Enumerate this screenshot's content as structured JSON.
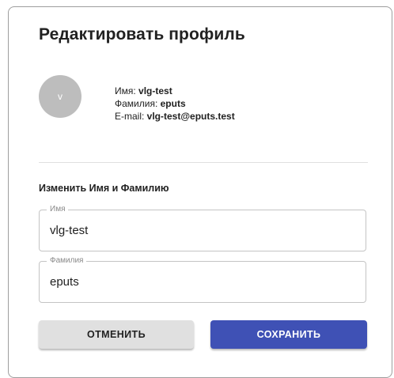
{
  "card": {
    "title": "Редактировать профиль"
  },
  "profile": {
    "avatar_letter": "v",
    "first_name_label": "Имя: ",
    "first_name": "vlg-test",
    "last_name_label": "Фамилия: ",
    "last_name": "eputs",
    "email_label": "E-mail: ",
    "email": "vlg-test@eputs.test"
  },
  "form": {
    "section_title": "Изменить Имя и Фамилию",
    "first_name_field": {
      "label": "Имя",
      "value": "vlg-test"
    },
    "last_name_field": {
      "label": "Фамилия",
      "value": "eputs"
    },
    "cancel_label": "ОТМЕНИТЬ",
    "save_label": "СОХРАНИТЬ"
  },
  "colors": {
    "primary": "#3f51b5",
    "avatar_bg": "#bdbdbd",
    "cancel_bg": "#e0e0e0"
  }
}
